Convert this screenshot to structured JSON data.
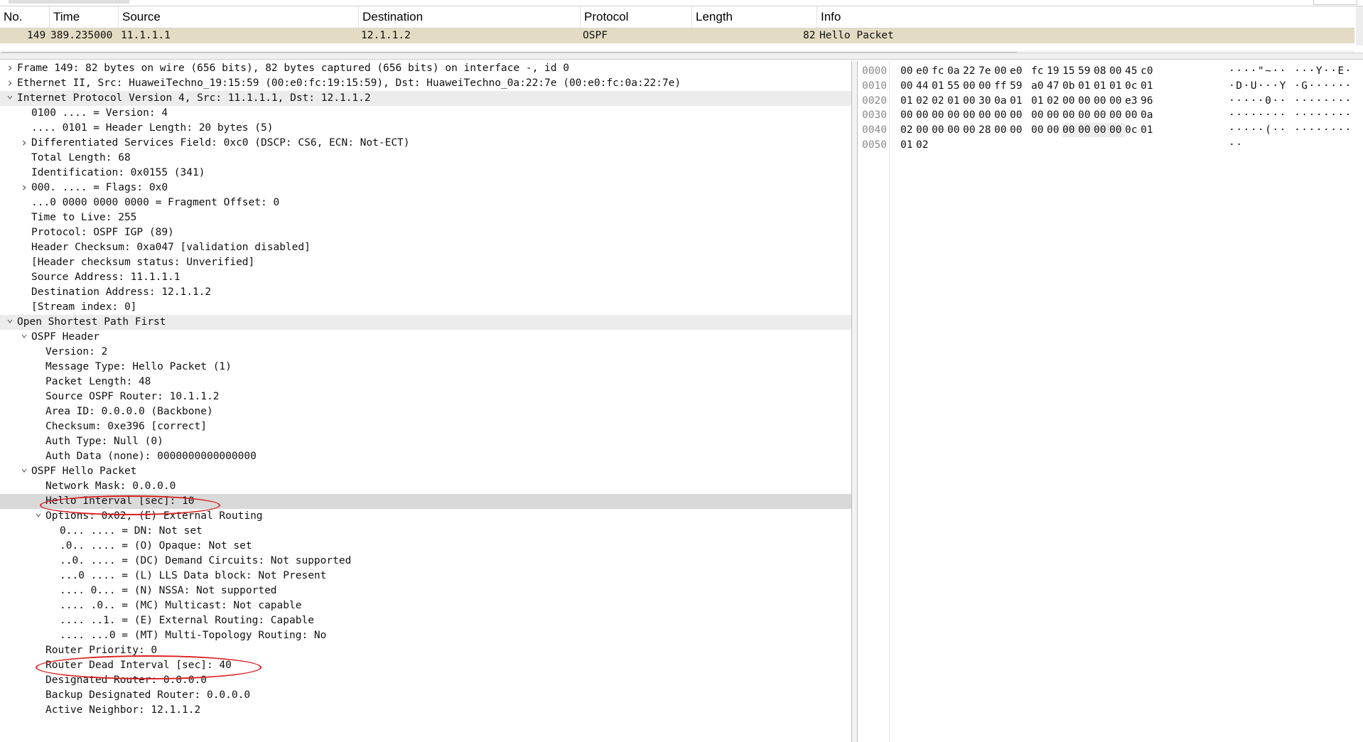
{
  "packet_list": {
    "columns": [
      "No.",
      "Time",
      "Source",
      "Destination",
      "Protocol",
      "Length",
      "Info"
    ],
    "rows": [
      {
        "no": "149",
        "time": "389.235000",
        "source": "11.1.1.1",
        "destination": "12.1.1.2",
        "protocol": "OSPF",
        "length": "82",
        "info": "Hello Packet"
      }
    ]
  },
  "details": {
    "rows": [
      {
        "arrow": ">",
        "text": "Frame 149: 82 bytes on wire (656 bits), 82 bytes captured (656 bits) on interface -, id 0"
      },
      {
        "arrow": ">",
        "text": "Ethernet II, Src: HuaweiTechno_19:15:59 (00:e0:fc:19:15:59), Dst: HuaweiTechno_0a:22:7e (00:e0:fc:0a:22:7e)"
      },
      {
        "arrow": "v",
        "text": "Internet Protocol Version 4, Src: 11.1.1.1, Dst: 12.1.1.2"
      },
      {
        "arrow": "",
        "text": "0100 .... = Version: 4"
      },
      {
        "arrow": "",
        "text": ".... 0101 = Header Length: 20 bytes (5)"
      },
      {
        "arrow": ">",
        "text": "Differentiated Services Field: 0xc0 (DSCP: CS6, ECN: Not-ECT)"
      },
      {
        "arrow": "",
        "text": "Total Length: 68"
      },
      {
        "arrow": "",
        "text": "Identification: 0x0155 (341)"
      },
      {
        "arrow": ">",
        "text": "000. .... = Flags: 0x0"
      },
      {
        "arrow": "",
        "text": "...0 0000 0000 0000 = Fragment Offset: 0"
      },
      {
        "arrow": "",
        "text": "Time to Live: 255"
      },
      {
        "arrow": "",
        "text": "Protocol: OSPF IGP (89)"
      },
      {
        "arrow": "",
        "text": "Header Checksum: 0xa047 [validation disabled]"
      },
      {
        "arrow": "",
        "text": "[Header checksum status: Unverified]"
      },
      {
        "arrow": "",
        "text": "Source Address: 11.1.1.1"
      },
      {
        "arrow": "",
        "text": "Destination Address: 12.1.1.2"
      },
      {
        "arrow": "",
        "text": "[Stream index: 0]"
      },
      {
        "arrow": "v",
        "text": "Open Shortest Path First"
      },
      {
        "arrow": "v",
        "text": "OSPF Header"
      },
      {
        "arrow": "",
        "text": "Version: 2"
      },
      {
        "arrow": "",
        "text": "Message Type: Hello Packet (1)"
      },
      {
        "arrow": "",
        "text": "Packet Length: 48"
      },
      {
        "arrow": "",
        "text": "Source OSPF Router: 10.1.1.2"
      },
      {
        "arrow": "",
        "text": "Area ID: 0.0.0.0 (Backbone)"
      },
      {
        "arrow": "",
        "text": "Checksum: 0xe396 [correct]"
      },
      {
        "arrow": "",
        "text": "Auth Type: Null (0)"
      },
      {
        "arrow": "",
        "text": "Auth Data (none): 0000000000000000"
      },
      {
        "arrow": "v",
        "text": "OSPF Hello Packet"
      },
      {
        "arrow": "",
        "text": "Network Mask: 0.0.0.0"
      },
      {
        "arrow": "",
        "text": "Hello Interval [sec]: 10"
      },
      {
        "arrow": "v",
        "text": "Options: 0x02, (E) External Routing"
      },
      {
        "arrow": "",
        "text": "0... .... = DN: Not set"
      },
      {
        "arrow": "",
        "text": ".0.. .... = (O) Opaque: Not set"
      },
      {
        "arrow": "",
        "text": "..0. .... = (DC) Demand Circuits: Not supported"
      },
      {
        "arrow": "",
        "text": "...0 .... = (L) LLS Data block: Not Present"
      },
      {
        "arrow": "",
        "text": ".... 0... = (N) NSSA: Not supported"
      },
      {
        "arrow": "",
        "text": ".... .0.. = (MC) Multicast: Not capable"
      },
      {
        "arrow": "",
        "text": ".... ..1. = (E) External Routing: Capable"
      },
      {
        "arrow": "",
        "text": ".... ...0 = (MT) Multi-Topology Routing: No"
      },
      {
        "arrow": "",
        "text": "Router Priority: 0"
      },
      {
        "arrow": "",
        "text": "Router Dead Interval [sec]: 40"
      },
      {
        "arrow": "",
        "text": "Designated Router: 0.0.0.0"
      },
      {
        "arrow": "",
        "text": "Backup Designated Router: 0.0.0.0"
      },
      {
        "arrow": "",
        "text": "Active Neighbor: 12.1.1.2"
      }
    ]
  },
  "bytes": {
    "rows": [
      {
        "offset": "0000",
        "hex": [
          "00",
          "e0",
          "fc",
          "0a",
          "22",
          "7e",
          "00",
          "e0",
          "fc",
          "19",
          "15",
          "59",
          "08",
          "00",
          "45",
          "c0"
        ],
        "ascii": "····\"~·· ···Y··E·"
      },
      {
        "offset": "0010",
        "hex": [
          "00",
          "44",
          "01",
          "55",
          "00",
          "00",
          "ff",
          "59",
          "a0",
          "47",
          "0b",
          "01",
          "01",
          "01",
          "0c",
          "01"
        ],
        "ascii": "·D·U···Y ·G······"
      },
      {
        "offset": "0020",
        "hex": [
          "01",
          "02",
          "02",
          "01",
          "00",
          "30",
          "0a",
          "01",
          "01",
          "02",
          "00",
          "00",
          "00",
          "00",
          "e3",
          "96"
        ],
        "ascii": "·····0·· ········"
      },
      {
        "offset": "0030",
        "hex": [
          "00",
          "00",
          "00",
          "00",
          "00",
          "00",
          "00",
          "00",
          "00",
          "00",
          "00",
          "00",
          "00",
          "00",
          "00",
          "0a"
        ],
        "ascii": "········ ········"
      },
      {
        "offset": "0040",
        "hex": [
          "02",
          "00",
          "00",
          "00",
          "00",
          "28",
          "00",
          "00",
          "00",
          "00",
          "00",
          "00",
          "00",
          "00",
          "0c",
          "01"
        ],
        "ascii": "·····(·· ········"
      },
      {
        "offset": "0050",
        "hex": [
          "01",
          "02"
        ],
        "ascii": "··"
      }
    ]
  },
  "colors": {
    "selected_row": "#e3dbc3",
    "annotation_circle": "#d92020"
  }
}
